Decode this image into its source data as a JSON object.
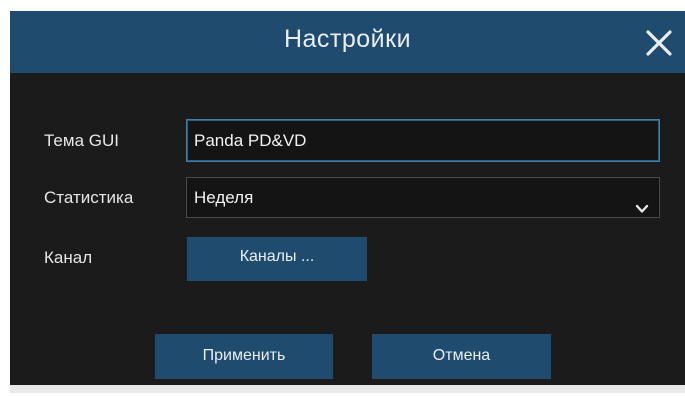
{
  "dialog": {
    "title": "Настройки",
    "close_icon": "close-icon"
  },
  "form": {
    "theme": {
      "label": "Тема GUI",
      "value": "Panda PD&VD"
    },
    "statistics": {
      "label": "Статистика",
      "value": "Неделя",
      "icon": "chevron-down-icon"
    },
    "channel": {
      "label": "Канал",
      "button_label": "Каналы ..."
    }
  },
  "actions": {
    "apply_label": "Применить",
    "cancel_label": "Отмена"
  },
  "colors": {
    "titlebar": "#1f4b6e",
    "background": "#1b1b1b",
    "button": "#1f4b6e",
    "input_focus_border": "#3e7fae"
  }
}
